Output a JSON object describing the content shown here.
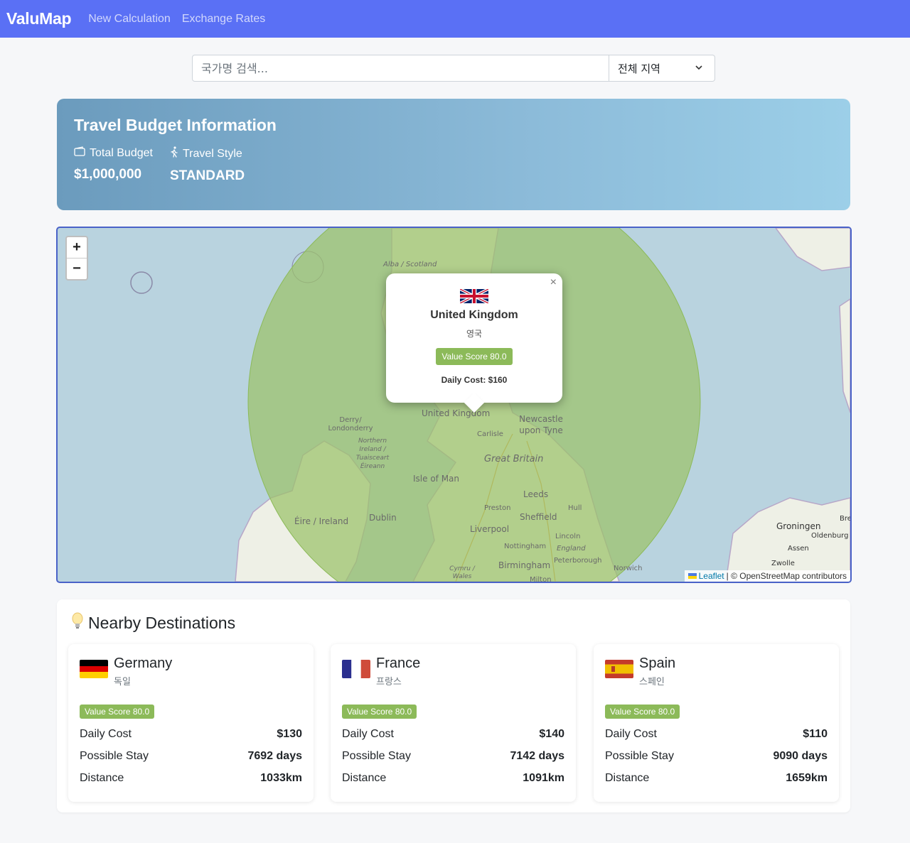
{
  "nav": {
    "brand": "ValuMap",
    "links": [
      "New Calculation",
      "Exchange Rates"
    ]
  },
  "search": {
    "placeholder": "국가명 검색...",
    "region_selected": "전체 지역"
  },
  "budget": {
    "title": "Travel Budget Information",
    "total_label": "Total Budget",
    "total_value": "$1,000,000",
    "style_label": "Travel Style",
    "style_value": "STANDARD"
  },
  "map": {
    "zoom_in": "+",
    "zoom_out": "−",
    "popup": {
      "close": "×",
      "flag": "united-kingdom-flag",
      "name": "United Kingdom",
      "local_name": "영국",
      "badge": "Value Score 80.0",
      "daily_cost": "Daily Cost: $160"
    },
    "labels": [
      "Alba / Scotland",
      "United Kingdom",
      "Newcastle upon Tyne",
      "Derry/ Londonderry",
      "Carlisle",
      "Northern Ireland / Tuaisceart Éireann",
      "Great Britain",
      "Isle of Man",
      "Leeds",
      "Preston",
      "Hull",
      "Sheffield",
      "Éire / Ireland",
      "Dublin",
      "Liverpool",
      "Lincoln",
      "Nottingham",
      "England",
      "Groningen",
      "Oldenburg",
      "Assen",
      "Bre",
      "Birmingham",
      "Peterborough",
      "Cymru / Wales",
      "Norwich",
      "Zwolle",
      "Milton"
    ],
    "attribution_leaflet": "Leaflet",
    "attribution_rest": "| © OpenStreetMap contributors",
    "circle_color": "#9bc26a"
  },
  "nearby": {
    "title": "Nearby Destinations",
    "icon": "lightbulb-icon",
    "labels": {
      "daily": "Daily Cost",
      "stay": "Possible Stay",
      "distance": "Distance"
    },
    "destinations": [
      {
        "name": "Germany",
        "local": "독일",
        "badge": "Value Score 80.0",
        "daily": "$130",
        "stay": "7692 days",
        "distance": "1033km"
      },
      {
        "name": "France",
        "local": "프랑스",
        "badge": "Value Score 80.0",
        "daily": "$140",
        "stay": "7142 days",
        "distance": "1091km"
      },
      {
        "name": "Spain",
        "local": "스페인",
        "badge": "Value Score 80.0",
        "daily": "$110",
        "stay": "9090 days",
        "distance": "1659km"
      }
    ]
  },
  "colors": {
    "nav": "#5a70f5",
    "badge": "#8cba59",
    "map_border": "#4a62c8"
  }
}
